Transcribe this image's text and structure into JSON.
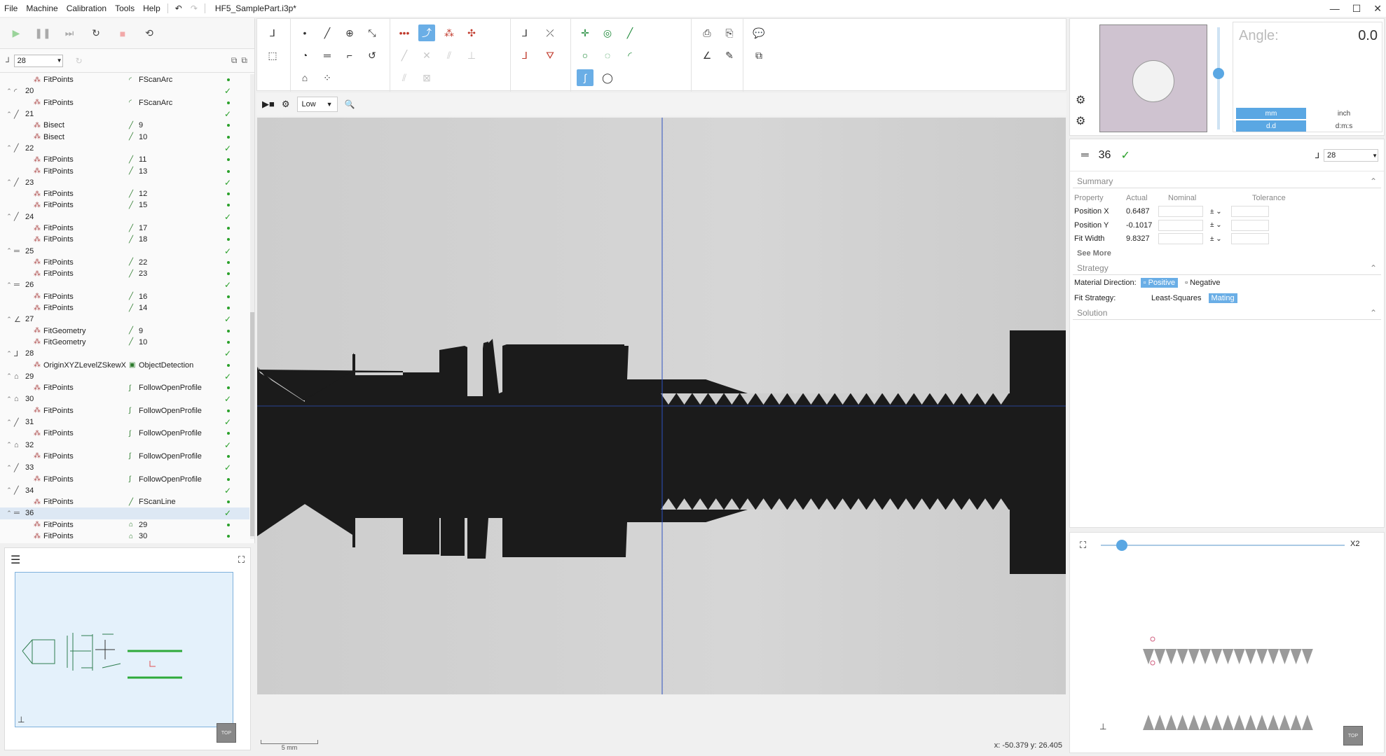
{
  "menu": {
    "items": [
      "File",
      "Machine",
      "Calibration",
      "Tools",
      "Help"
    ],
    "doc_title": "HF5_SamplePart.i3p*"
  },
  "feature_select": {
    "value": "28"
  },
  "tree": [
    {
      "type": "child",
      "name": "FitPoints",
      "ref": "FScanArc",
      "ricon": "arc"
    },
    {
      "type": "parent",
      "id": "20",
      "icon": "arc",
      "ok": true
    },
    {
      "type": "child",
      "name": "FitPoints",
      "ref": "FScanArc",
      "ricon": "arc"
    },
    {
      "type": "parent",
      "id": "21",
      "icon": "line",
      "ok": true
    },
    {
      "type": "child",
      "name": "Bisect",
      "ref": "9",
      "ricon": "line"
    },
    {
      "type": "child",
      "name": "Bisect",
      "ref": "10",
      "ricon": "line"
    },
    {
      "type": "parent",
      "id": "22",
      "icon": "line",
      "ok": true
    },
    {
      "type": "child",
      "name": "FitPoints",
      "ref": "11",
      "ricon": "line"
    },
    {
      "type": "child",
      "name": "FitPoints",
      "ref": "13",
      "ricon": "line"
    },
    {
      "type": "parent",
      "id": "23",
      "icon": "line",
      "ok": true
    },
    {
      "type": "child",
      "name": "FitPoints",
      "ref": "12",
      "ricon": "line"
    },
    {
      "type": "child",
      "name": "FitPoints",
      "ref": "15",
      "ricon": "line"
    },
    {
      "type": "parent",
      "id": "24",
      "icon": "line",
      "ok": true
    },
    {
      "type": "child",
      "name": "FitPoints",
      "ref": "17",
      "ricon": "line"
    },
    {
      "type": "child",
      "name": "FitPoints",
      "ref": "18",
      "ricon": "line"
    },
    {
      "type": "parent",
      "id": "25",
      "icon": "parallel",
      "ok": true
    },
    {
      "type": "child",
      "name": "FitPoints",
      "ref": "22",
      "ricon": "line"
    },
    {
      "type": "child",
      "name": "FitPoints",
      "ref": "23",
      "ricon": "line"
    },
    {
      "type": "parent",
      "id": "26",
      "icon": "parallel",
      "ok": true
    },
    {
      "type": "child",
      "name": "FitPoints",
      "ref": "16",
      "ricon": "line"
    },
    {
      "type": "child",
      "name": "FitPoints",
      "ref": "14",
      "ricon": "line"
    },
    {
      "type": "parent",
      "id": "27",
      "icon": "angle",
      "ok": true
    },
    {
      "type": "child",
      "name": "FitGeometry",
      "ref": "9",
      "ricon": "line"
    },
    {
      "type": "child",
      "name": "FitGeometry",
      "ref": "10",
      "ricon": "line"
    },
    {
      "type": "parent",
      "id": "28",
      "icon": "origin",
      "ok": true
    },
    {
      "type": "child",
      "name": "OriginXYZLevelZSkewX",
      "ref": "ObjectDetection",
      "ricon": "box"
    },
    {
      "type": "parent",
      "id": "29",
      "icon": "profile",
      "ok": true
    },
    {
      "type": "child",
      "name": "FitPoints",
      "ref": "FollowOpenProfile",
      "ricon": "curve"
    },
    {
      "type": "parent",
      "id": "30",
      "icon": "profile",
      "ok": true
    },
    {
      "type": "child",
      "name": "FitPoints",
      "ref": "FollowOpenProfile",
      "ricon": "curve"
    },
    {
      "type": "parent",
      "id": "31",
      "icon": "line",
      "ok": true
    },
    {
      "type": "child",
      "name": "FitPoints",
      "ref": "FollowOpenProfile",
      "ricon": "curve"
    },
    {
      "type": "parent",
      "id": "32",
      "icon": "profile",
      "ok": true
    },
    {
      "type": "child",
      "name": "FitPoints",
      "ref": "FollowOpenProfile",
      "ricon": "curve"
    },
    {
      "type": "parent",
      "id": "33",
      "icon": "line",
      "ok": true
    },
    {
      "type": "child",
      "name": "FitPoints",
      "ref": "FollowOpenProfile",
      "ricon": "curve"
    },
    {
      "type": "parent",
      "id": "34",
      "icon": "line",
      "ok": true
    },
    {
      "type": "child",
      "name": "FitPoints",
      "ref": "FScanLine",
      "ricon": "line"
    },
    {
      "type": "parent",
      "id": "36",
      "icon": "parallel",
      "ok": true,
      "selected": true
    },
    {
      "type": "child",
      "name": "FitPoints",
      "ref": "29",
      "ricon": "profile"
    },
    {
      "type": "child",
      "name": "FitPoints",
      "ref": "30",
      "ricon": "profile"
    }
  ],
  "camera": {
    "quality": "Low"
  },
  "status": {
    "coords": "x: -50.379 y: 26.405",
    "scale": "5 mm"
  },
  "preview": {
    "angle_label": "Angle:",
    "angle_value": "0.0",
    "unit_mm": "mm",
    "unit_inch": "inch",
    "unit_dd": "d.d",
    "unit_dms": "d:m:s"
  },
  "feature": {
    "id": "36",
    "ref_select": "28",
    "summary_title": "Summary",
    "headers": [
      "Property",
      "Actual",
      "Nominal",
      "Tolerance"
    ],
    "props": [
      {
        "name": "Position X",
        "actual": "0.6487",
        "pm": "±"
      },
      {
        "name": "Position Y",
        "actual": "-0.1017",
        "pm": "±"
      },
      {
        "name": "Fit Width",
        "actual": "9.8327",
        "pm": "±"
      }
    ],
    "see_more": "See More",
    "strategy_title": "Strategy",
    "material_dir_label": "Material Direction:",
    "material_positive": "Positive",
    "material_negative": "Negative",
    "fit_strategy_label": "Fit Strategy:",
    "fit_least": "Least-Squares",
    "fit_mating": "Mating",
    "solution_title": "Solution"
  },
  "zoom": {
    "label": "X2"
  },
  "colors": {
    "accent": "#6aaee6",
    "ok": "#2aa02a",
    "part": "#1a1a1a",
    "bg_view": "#cfcfcf"
  }
}
